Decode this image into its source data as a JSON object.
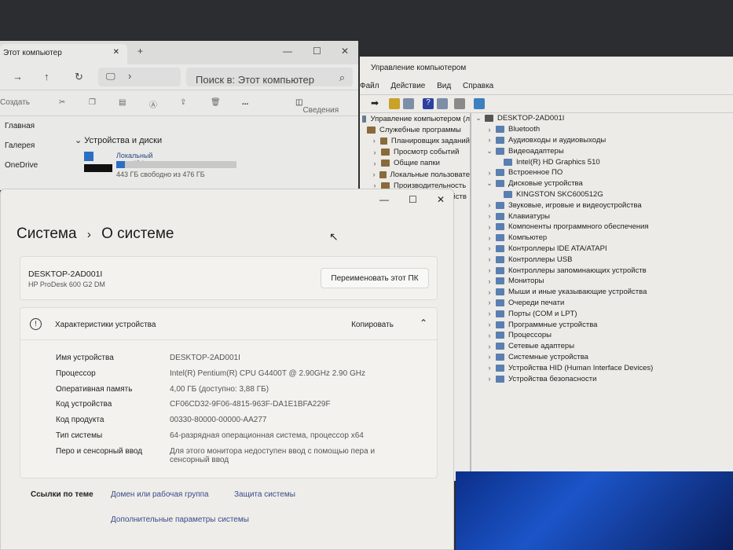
{
  "explorer": {
    "tab_title": "Этот компьютер",
    "new_tab": "+",
    "search_placeholder": "Поиск в: Этот компьютер",
    "create": "Создать",
    "more": "...",
    "details": "Сведения",
    "sidebar": [
      "Главная",
      "Галерея",
      "OneDrive"
    ],
    "section": "Устройства и диски",
    "drive_name": "Локальный диск (C:)",
    "drive_free": "443 ГБ свободно из 476 ГБ",
    "drive_used_fraction": 0.07
  },
  "cm": {
    "title": "Управление компьютером",
    "menu": [
      "Файл",
      "Действие",
      "Вид",
      "Справка"
    ],
    "left_tree": [
      "Управление компьютером (л",
      "Служебные программы",
      "Планировщик заданий",
      "Просмотр событий",
      "Общие папки",
      "Локальные пользовате",
      "Производительность",
      "Диспетчер устройств"
    ],
    "root": "DESKTOP-2AD001I",
    "devices": [
      {
        "label": "Bluetooth",
        "expanded": false,
        "child": false
      },
      {
        "label": "Аудиовходы и аудиовыходы",
        "expanded": false,
        "child": false
      },
      {
        "label": "Видеоадаптеры",
        "expanded": true,
        "child": false
      },
      {
        "label": "Intel(R) HD Graphics 510",
        "child": true
      },
      {
        "label": "Встроенное ПО",
        "expanded": false,
        "child": false
      },
      {
        "label": "Дисковые устройства",
        "expanded": true,
        "child": false
      },
      {
        "label": "KINGSTON SKC600512G",
        "child": true
      },
      {
        "label": "Звуковые, игровые и видеоустройства",
        "child": false
      },
      {
        "label": "Клавиатуры",
        "child": false
      },
      {
        "label": "Компоненты программного обеспечения",
        "child": false
      },
      {
        "label": "Компьютер",
        "child": false
      },
      {
        "label": "Контроллеры IDE ATA/ATAPI",
        "child": false
      },
      {
        "label": "Контроллеры USB",
        "child": false
      },
      {
        "label": "Контроллеры запоминающих устройств",
        "child": false
      },
      {
        "label": "Мониторы",
        "child": false
      },
      {
        "label": "Мыши и иные указывающие устройства",
        "child": false
      },
      {
        "label": "Очереди печати",
        "child": false
      },
      {
        "label": "Порты (COM и LPT)",
        "child": false
      },
      {
        "label": "Программные устройства",
        "child": false
      },
      {
        "label": "Процессоры",
        "child": false
      },
      {
        "label": "Сетевые адаптеры",
        "child": false
      },
      {
        "label": "Системные устройства",
        "child": false
      },
      {
        "label": "Устройства HID (Human Interface Devices)",
        "child": false
      },
      {
        "label": "Устройства безопасности",
        "child": false
      }
    ]
  },
  "settings": {
    "crumb_parent": "Система",
    "crumb_sep": "›",
    "crumb_current": "О системе",
    "pc_name": "DESKTOP-2AD001I",
    "pc_model": "HP ProDesk 600 G2 DM",
    "rename": "Переименовать этот ПК",
    "specs_title": "Характеристики устройства",
    "copy": "Копировать",
    "specs": [
      {
        "k": "Имя устройства",
        "v": "DESKTOP-2AD001I"
      },
      {
        "k": "Процессор",
        "v": "Intel(R) Pentium(R) CPU G4400T @ 2.90GHz   2.90 GHz"
      },
      {
        "k": "Оперативная память",
        "v": "4,00 ГБ (доступно: 3,88 ГБ)"
      },
      {
        "k": "Код устройства",
        "v": "CF06CD32-9F06-4815-963F-DA1E1BFA229F"
      },
      {
        "k": "Код продукта",
        "v": "00330-80000-00000-AA277"
      },
      {
        "k": "Тип системы",
        "v": "64-разрядная операционная система, процессор x64"
      },
      {
        "k": "Перо и сенсорный ввод",
        "v": "Для этого монитора недоступен ввод с помощью пера и сенсорный ввод"
      }
    ],
    "links_label": "Ссылки по теме",
    "links": [
      "Домен или рабочая группа",
      "Защита системы",
      "Дополнительные параметры системы"
    ]
  }
}
